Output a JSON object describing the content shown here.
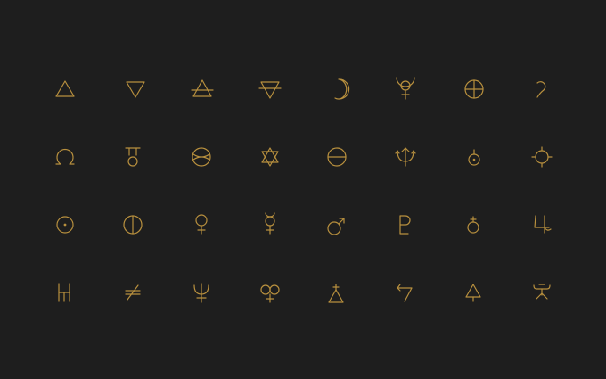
{
  "background_color": "#1e1e1e",
  "accent_color": "#b8903e",
  "symbols": [
    [
      "fire-triangle",
      "water-triangle",
      "air-triangle",
      "earth-triangle",
      "crescent-moon",
      "pluto-bident",
      "earth-cross-circle",
      "crescent-curl"
    ],
    [
      "omega-ligature",
      "uranus-glyph",
      "salt-circle",
      "hexagram-star",
      "horizon-circle",
      "trident-arrow",
      "circle-dot-orb",
      "circle-flame-orb"
    ],
    [
      "sun-circle-dot",
      "halved-circle",
      "venus-glyph",
      "mercury-glyph",
      "mars-glyph",
      "pluto-pl-glyph",
      "orb-cross",
      "jupiter-glyph"
    ],
    [
      "antimony-bars",
      "crossed-slash",
      "neptune-glyph",
      "twin-loops-glyph",
      "sulfur-triangle",
      "bent-arrow",
      "lead-triangle",
      "tau-cross"
    ]
  ]
}
